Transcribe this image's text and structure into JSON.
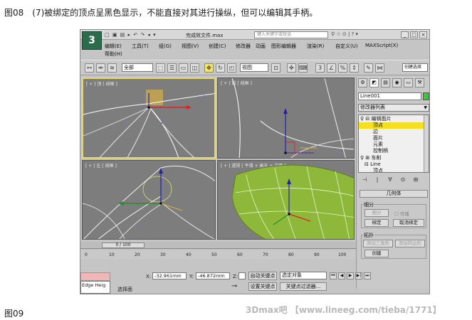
{
  "caption_top": {
    "figure": "图08",
    "text": "(7)被绑定的顶点呈黑色显示，不能直接对其进行操纵，但可以编辑其手柄。"
  },
  "caption_bottom": "图09",
  "credit": "3Dmax吧 【www.lineeg.com/tieba/1771】",
  "app": {
    "logo": "3",
    "quick_access": "□ ▣ ▤ ▸ ↶ ↷ ◂ ▾",
    "doc_title": "完成效文件.max",
    "search_placeholder": "键入关键字或短语",
    "title_icons": "⚲ ☆ ⊙ | ? ▾",
    "window_controls": [
      "_",
      "□",
      "×"
    ],
    "menu": [
      "编辑(E)",
      "工具(T)",
      "组(G)",
      "视图(V)",
      "创建(C)",
      "修改器",
      "动画",
      "图形编辑器",
      "渲染(R)",
      "自定义(U)",
      "MAXScript(X)",
      "帮助(H)"
    ],
    "toolbar": {
      "selection_filter": "全部",
      "ref_coord": "视图",
      "named_set": "创建选择"
    },
    "viewports": [
      {
        "label": "[ + ] 顶 [ 线框 ]"
      },
      {
        "label": "[ + ] 前 [ 线框 ]"
      },
      {
        "label": "[ + ] 左 [ 线框 ]"
      },
      {
        "label": "[ + ] 透视 [ 平滑 + 高光 + 边面 ]"
      }
    ],
    "command_panel": {
      "tabs": [
        "⚙",
        "◩",
        "▤",
        "◉",
        "▭",
        "⚒"
      ],
      "object_name": "Line001",
      "object_color": "#33cc33",
      "modifier_list": "修改器列表",
      "stack": [
        {
          "text": "♀ ⊟ 编辑面片",
          "indent": 0,
          "selected": false
        },
        {
          "text": "顶点",
          "indent": 1,
          "selected": true
        },
        {
          "text": "边",
          "indent": 1,
          "selected": false
        },
        {
          "text": "面片",
          "indent": 1,
          "selected": false
        },
        {
          "text": "元素",
          "indent": 1,
          "selected": false
        },
        {
          "text": "控制柄",
          "indent": 1,
          "selected": false
        },
        {
          "text": "♀ ⊞ 车削",
          "indent": 0,
          "selected": false
        },
        {
          "text": "⊟ Line",
          "indent": 0,
          "selected": false
        },
        {
          "text": "顶点",
          "indent": 1,
          "selected": false
        }
      ],
      "stack_tools": [
        "⊣",
        "|",
        "∀",
        "⊙",
        "⊞"
      ],
      "rollout_title": "几何体",
      "group_subdivision": {
        "title": "细分",
        "subdivide_btn": "细分",
        "propagate_label": "传播",
        "bind_btn": "绑定",
        "unbind_btn": "取消绑定"
      },
      "group_topology": {
        "title": "拓扑",
        "add_tri_btn": "添加三角形",
        "add_quad_btn": "添加四边形",
        "create_btn": "创建"
      }
    },
    "timeline": {
      "frame_counter": "0 / 100",
      "ruler": [
        "0",
        "10",
        "20",
        "30",
        "40",
        "50",
        "60",
        "70",
        "80",
        "90",
        "100"
      ]
    },
    "status": {
      "x_label": "X:",
      "x_value": "-32.961mm",
      "y_label": "Y:",
      "y_value": "-46.872mm",
      "z_label": "Z:",
      "auto_key": "自动关键点",
      "set_key": "设置关键点",
      "key_filter": "关键点过滤器...",
      "selected_object": "选定对象",
      "prompt": "选择面",
      "maxscript": "Edge Heig",
      "playback": [
        "⏮",
        "◀",
        "▶",
        "▶|",
        "⏭"
      ]
    }
  }
}
